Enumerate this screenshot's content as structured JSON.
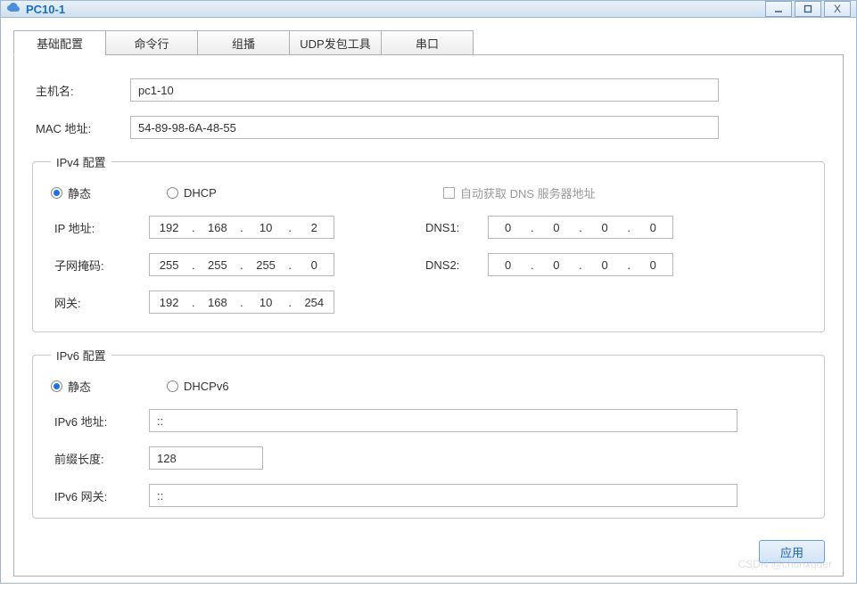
{
  "window": {
    "title": "PC10-1"
  },
  "tabs": {
    "items": [
      {
        "label": "基础配置",
        "active": true
      },
      {
        "label": "命令行"
      },
      {
        "label": "组播"
      },
      {
        "label": "UDP发包工具"
      },
      {
        "label": "串口"
      }
    ]
  },
  "basic": {
    "hostname_label": "主机名:",
    "hostname_value": "pc1-10",
    "mac_label": "MAC 地址:",
    "mac_value": "54-89-98-6A-48-55"
  },
  "ipv4": {
    "legend": "IPv4 配置",
    "static_label": "静态",
    "dhcp_label": "DHCP",
    "auto_dns_label": "自动获取 DNS 服务器地址",
    "mode": "static",
    "ip_label": "IP 地址:",
    "ip": [
      "192",
      "168",
      "10",
      "2"
    ],
    "mask_label": "子网掩码:",
    "mask": [
      "255",
      "255",
      "255",
      "0"
    ],
    "gateway_label": "网关:",
    "gateway": [
      "192",
      "168",
      "10",
      "254"
    ],
    "dns1_label": "DNS1:",
    "dns1": [
      "0",
      "0",
      "0",
      "0"
    ],
    "dns2_label": "DNS2:",
    "dns2": [
      "0",
      "0",
      "0",
      "0"
    ]
  },
  "ipv6": {
    "legend": "IPv6 配置",
    "static_label": "静态",
    "dhcpv6_label": "DHCPv6",
    "mode": "static",
    "addr_label": "IPv6 地址:",
    "addr_value": "::",
    "prefix_label": "前缀长度:",
    "prefix_value": "128",
    "gateway_label": "IPv6 网关:",
    "gateway_value": "::"
  },
  "footer": {
    "apply_label": "应用"
  },
  "watermark": "CSDN @chunxquer"
}
